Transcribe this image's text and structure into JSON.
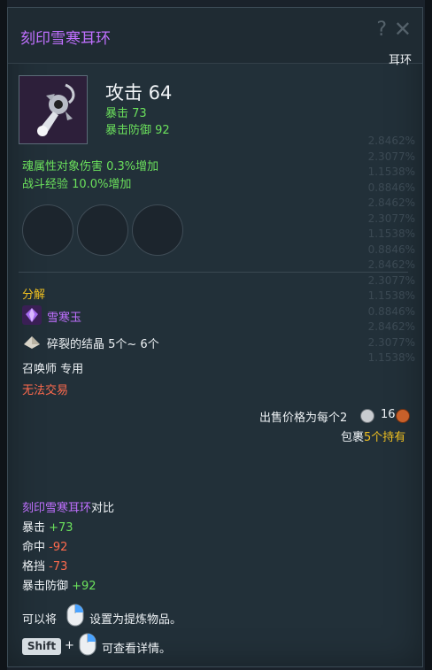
{
  "tooltip": {
    "title": "刻印雪寒耳环",
    "type_label": "耳环",
    "help_glyph": "?",
    "close_glyph": "✕",
    "attack_label": "攻击 64",
    "stats": [
      "暴击 73",
      "暴击防御 92"
    ],
    "bonuses": [
      "魂属性对象伤害 0.3%增加",
      "战斗经验 10.0%增加"
    ],
    "decompose_heading": "分解",
    "decompose_items": [
      {
        "name": "雪寒玉",
        "icon": "gem-icon"
      },
      {
        "name": "碎裂的结晶 5个~ 6个",
        "icon": "crystal-icon"
      }
    ],
    "class_restriction": "召唤师 专用",
    "trade_restriction": "无法交易",
    "sell_price_label": "出售价格为每个2",
    "sell_price_silver": "16",
    "bag_prefix": "包裹",
    "bag_count": "5个持有",
    "compare": {
      "item_name": "刻印雪寒耳环",
      "suffix": "对比",
      "rows": [
        {
          "label": "暴击 ",
          "value": "+73",
          "tone": "green"
        },
        {
          "label": "命中 ",
          "value": "-92",
          "tone": "red"
        },
        {
          "label": "格挡 ",
          "value": "-73",
          "tone": "red"
        },
        {
          "label": "暴击防御 ",
          "value": "+92",
          "tone": "green"
        }
      ]
    },
    "hint_refine_a": "可以将",
    "hint_refine_b": "设置为提炼物品。",
    "hint_shift_key": "Shift",
    "hint_plus": "+",
    "hint_detail": "可查看详情。"
  },
  "background_faint_values": [
    "2.8462%",
    "2.3077%",
    "1.1538%",
    "0.8846%",
    "2.8462%",
    "2.3077%",
    "1.1538%",
    "0.8846%",
    "2.8462%",
    "2.3077%",
    "1.1538%",
    "0.8846%",
    "2.8462%",
    "2.3077%",
    "1.1538%"
  ],
  "colors": {
    "title": "#c070ff",
    "stat_green": "#6be05c",
    "warning_red": "#ff6a4d",
    "gold": "#f0c020",
    "panel_bg": "#223039"
  }
}
